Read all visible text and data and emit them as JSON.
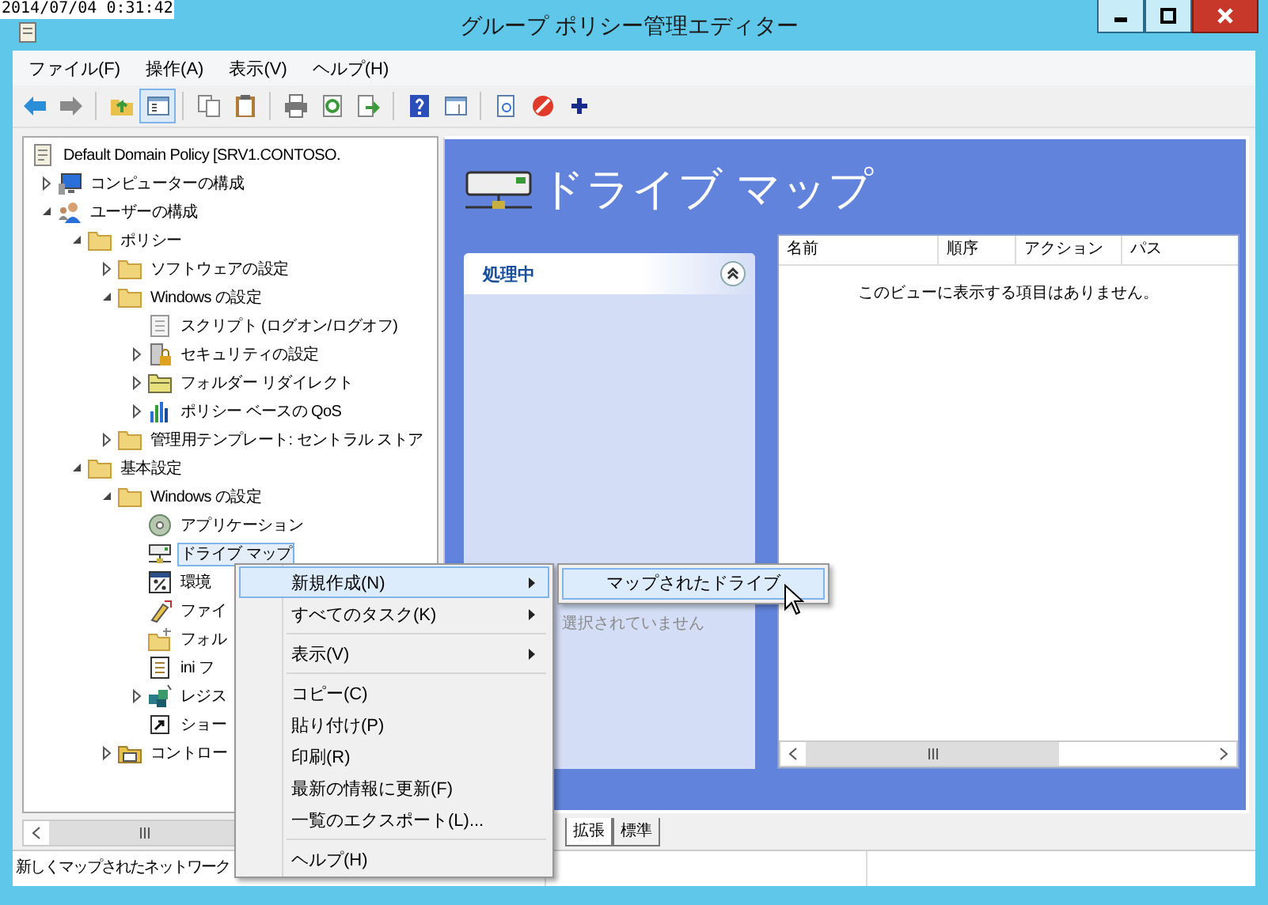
{
  "timestamp": "2014/07/04 0:31:42",
  "window": {
    "title": "グループ ポリシー管理エディター"
  },
  "window_controls": [
    {
      "kind": "minimize"
    },
    {
      "kind": "maximize"
    },
    {
      "kind": "close"
    }
  ],
  "menu_bar": [
    "ファイル(F)",
    "操作(A)",
    "表示(V)",
    "ヘルプ(H)"
  ],
  "toolbar": [
    [
      {
        "kind": "back",
        "selected": false
      },
      {
        "kind": "forward",
        "selected": false
      }
    ],
    [
      {
        "kind": "up",
        "selected": false
      },
      {
        "kind": "tree",
        "selected": true
      }
    ],
    [
      {
        "kind": "copy",
        "selected": false
      },
      {
        "kind": "paste",
        "selected": false
      }
    ],
    [
      {
        "kind": "print",
        "selected": false
      },
      {
        "kind": "refresh",
        "selected": false
      },
      {
        "kind": "export",
        "selected": false
      }
    ],
    [
      {
        "kind": "help",
        "selected": false
      },
      {
        "kind": "pane",
        "selected": false
      }
    ],
    [
      {
        "kind": "properties",
        "selected": false
      },
      {
        "kind": "stop",
        "selected": false
      },
      {
        "kind": "add",
        "selected": false
      }
    ]
  ],
  "tree": {
    "root": {
      "label": "Default Domain Policy [SRV1.CONTOSO.",
      "kind": "scroll",
      "children": [
        {
          "label": "コンピューターの構成",
          "kind": "computer",
          "expanded": false,
          "selected": false
        },
        {
          "label": "ユーザーの構成",
          "kind": "users",
          "expanded": true,
          "selected": false,
          "children": [
            {
              "label": "ポリシー",
              "kind": "folder",
              "expanded": true,
              "selected": false,
              "children": [
                {
                  "label": "ソフトウェアの設定",
                  "kind": "folder",
                  "expanded": false,
                  "selected": false
                },
                {
                  "label": "Windows の設定",
                  "kind": "folder",
                  "expanded": true,
                  "selected": false,
                  "children": [
                    {
                      "label": "スクリプト (ログオン/ログオフ)",
                      "kind": "script",
                      "selected": false
                    },
                    {
                      "label": "セキュリティの設定",
                      "kind": "security",
                      "expanded": false,
                      "selected": false
                    },
                    {
                      "label": "フォルダー リダイレクト",
                      "kind": "redirect",
                      "expanded": false,
                      "selected": false
                    },
                    {
                      "label": "ポリシー ベースの QoS",
                      "kind": "chart",
                      "expanded": false,
                      "selected": false
                    }
                  ]
                },
                {
                  "label": "管理用テンプレート: セントラル ストア",
                  "kind": "folder",
                  "expanded": false,
                  "selected": false
                }
              ]
            },
            {
              "label": "基本設定",
              "kind": "folder",
              "expanded": true,
              "selected": false,
              "children": [
                {
                  "label": "Windows の設定",
                  "kind": "folder",
                  "expanded": true,
                  "selected": false,
                  "children": [
                    {
                      "label": "アプリケーション",
                      "kind": "disc",
                      "selected": false
                    },
                    {
                      "label": "ドライブ マップ",
                      "kind": "drive",
                      "selected": true
                    },
                    {
                      "label": "環境",
                      "kind": "percent",
                      "selected": false
                    },
                    {
                      "label": "ファイ",
                      "kind": "file",
                      "selected": false
                    },
                    {
                      "label": "フォル",
                      "kind": "newfolder",
                      "selected": false
                    },
                    {
                      "label": "ini フ",
                      "kind": "ini",
                      "selected": false
                    },
                    {
                      "label": "レジス",
                      "kind": "registry",
                      "expanded": false,
                      "selected": false
                    },
                    {
                      "label": "ショー",
                      "kind": "shortcut",
                      "selected": false
                    }
                  ]
                },
                {
                  "label": "コントロー",
                  "kind": "control",
                  "expanded": false,
                  "selected": false
                }
              ]
            }
          ]
        }
      ]
    }
  },
  "details": {
    "title": "ドライブ マップ",
    "task_pane": {
      "title": "処理中",
      "expanded": true,
      "message": "選択されていません"
    },
    "list": {
      "columns": [
        "名前",
        "順序",
        "アクション",
        "パス"
      ],
      "empty_message": "このビューに表示する項目はありません。"
    }
  },
  "view_tabs": [
    {
      "label": "拡張",
      "selected": true
    },
    {
      "label": "標準",
      "selected": false
    }
  ],
  "status_bar": {
    "text": "新しくマップされたネットワーク"
  },
  "context_menu": [
    {
      "kind": "item",
      "label": "新規作成(N)",
      "submenu": true,
      "selected": true
    },
    {
      "kind": "item",
      "label": "すべてのタスク(K)",
      "submenu": true,
      "selected": false
    },
    {
      "kind": "separator"
    },
    {
      "kind": "item",
      "label": "表示(V)",
      "submenu": true,
      "selected": false
    },
    {
      "kind": "separator"
    },
    {
      "kind": "item",
      "label": "コピー(C)",
      "submenu": false,
      "selected": false
    },
    {
      "kind": "item",
      "label": "貼り付け(P)",
      "submenu": false,
      "selected": false
    },
    {
      "kind": "item",
      "label": "印刷(R)",
      "submenu": false,
      "selected": false
    },
    {
      "kind": "item",
      "label": "最新の情報に更新(F)",
      "submenu": false,
      "selected": false
    },
    {
      "kind": "item",
      "label": "一覧のエクスポート(L)...",
      "submenu": false,
      "selected": false
    },
    {
      "kind": "separator"
    },
    {
      "kind": "item",
      "label": "ヘルプ(H)",
      "submenu": false,
      "selected": false
    }
  ],
  "submenu": [
    {
      "label": "マップされたドライブ",
      "selected": true
    }
  ]
}
